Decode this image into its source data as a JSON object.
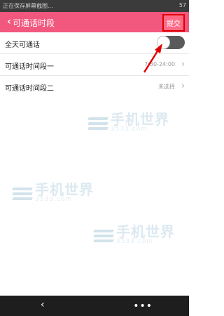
{
  "status_bar": {
    "notice": "正在保存屏幕截图...",
    "battery": "57"
  },
  "header": {
    "title": "可通话时段",
    "submit_label": "提交"
  },
  "settings": {
    "all_day_label": "全天可通话",
    "all_day_enabled": false,
    "period_one_label": "可通话时间段一",
    "period_one_value": "7:30-24:00",
    "period_two_label": "可通话时间段二",
    "period_two_value": "未选择"
  },
  "watermark": {
    "main": "手机世界",
    "sub": "3533.com"
  },
  "colors": {
    "header_bg": "#f2577e",
    "highlight_border": "#e10000"
  },
  "icons": {
    "back": "chevron-left-icon",
    "chevron": "chevron-right-icon",
    "menu": "more-dots-icon"
  }
}
